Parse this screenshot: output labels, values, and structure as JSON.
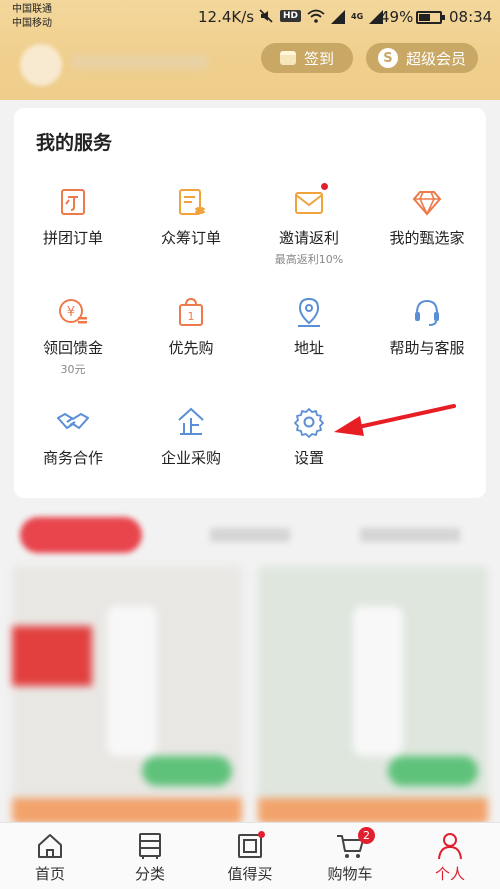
{
  "status_bar": {
    "carrier1": "中国联通",
    "carrier2": "中国移动",
    "net_speed": "12.4K/s",
    "hd": "HD",
    "net_type": "4G",
    "battery": "49%",
    "time": "08:34"
  },
  "header": {
    "checkin_label": "签到",
    "vip_label": "超级会员",
    "vip_icon_glyph": "S"
  },
  "services": {
    "title": "我的服务",
    "items": [
      {
        "label": "拼团订单",
        "sub": "",
        "icon": "group-order-icon"
      },
      {
        "label": "众筹订单",
        "sub": "",
        "icon": "crowdfund-order-icon"
      },
      {
        "label": "邀请返利",
        "sub": "最高返利10%",
        "icon": "invite-envelope-icon"
      },
      {
        "label": "我的甄选家",
        "sub": "",
        "icon": "diamond-icon"
      },
      {
        "label": "领回馈金",
        "sub": "30元",
        "icon": "yen-coin-icon"
      },
      {
        "label": "优先购",
        "sub": "",
        "icon": "shopping-bag-icon"
      },
      {
        "label": "地址",
        "sub": "",
        "icon": "location-pin-icon"
      },
      {
        "label": "帮助与客服",
        "sub": "",
        "icon": "headset-icon"
      },
      {
        "label": "商务合作",
        "sub": "",
        "icon": "handshake-icon"
      },
      {
        "label": "企业采购",
        "sub": "",
        "icon": "enterprise-icon"
      },
      {
        "label": "设置",
        "sub": "",
        "icon": "gear-icon"
      }
    ]
  },
  "bottom_nav": {
    "items": [
      {
        "label": "首页",
        "icon": "home-icon"
      },
      {
        "label": "分类",
        "icon": "category-icon"
      },
      {
        "label": "值得买",
        "icon": "worth-buy-icon"
      },
      {
        "label": "购物车",
        "icon": "cart-icon",
        "badge": "2"
      },
      {
        "label": "个人",
        "icon": "person-icon"
      }
    ],
    "active_index": 4
  },
  "colors": {
    "accent": "#e0202f",
    "orange_icon": "#ee7a4b",
    "blue_icon": "#5a8fd6",
    "gold": "#c9a764"
  }
}
